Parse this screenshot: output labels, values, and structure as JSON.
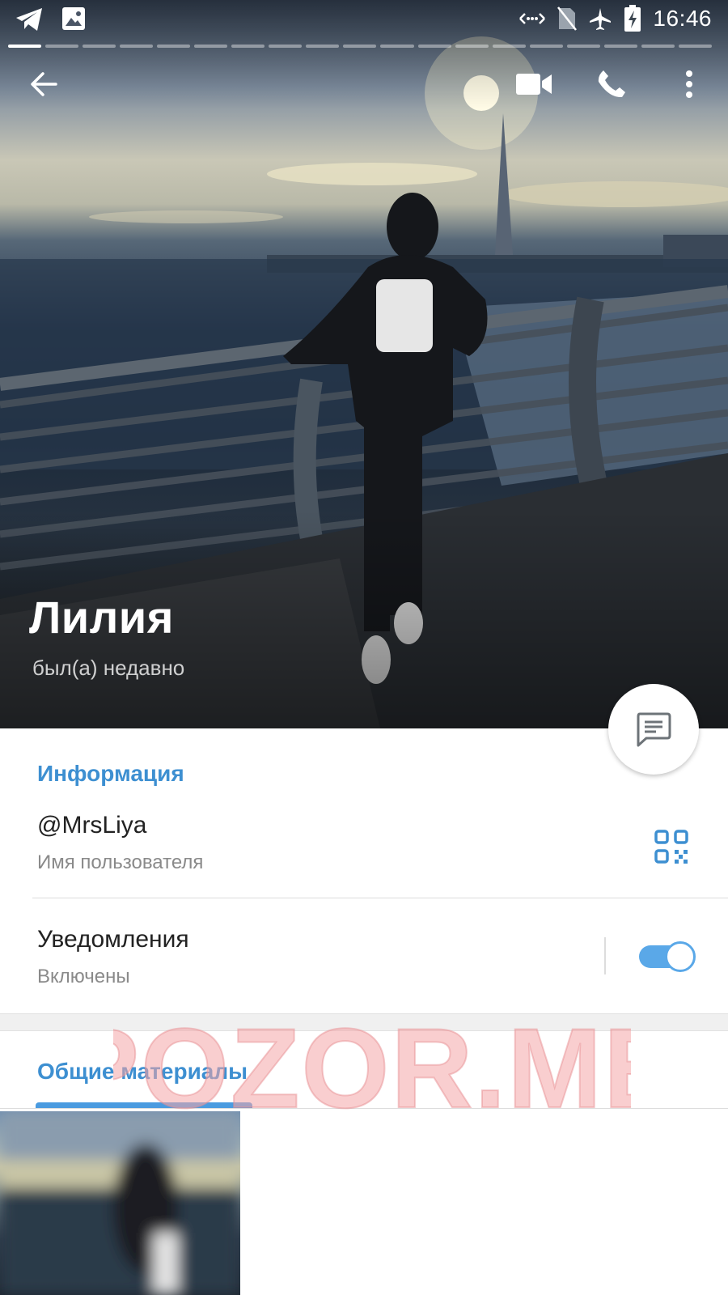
{
  "status_bar": {
    "time": "16:46",
    "left_icons": [
      "telegram-icon",
      "image-icon"
    ],
    "right_icons": [
      "data-sync-icon",
      "no-sim-icon",
      "airplane-icon",
      "battery-charging-icon"
    ]
  },
  "story": {
    "segments": 19,
    "active_index": 0
  },
  "topbar": {
    "icons": [
      "back-arrow-icon",
      "video-call-icon",
      "phone-icon",
      "more-vert-icon"
    ]
  },
  "profile": {
    "name": "Лилия",
    "status": "был(а) недавно"
  },
  "info": {
    "section_title": "Информация",
    "username": "@MrsLiya",
    "username_caption": "Имя пользователя",
    "notifications_label": "Уведомления",
    "notifications_state": "Включены",
    "notifications_on": true
  },
  "shared": {
    "tab_label": "Общие материалы"
  },
  "watermark": "POZOR.ME",
  "colors": {
    "accent": "#3d8fd1",
    "toggle": "#5aa8e8",
    "watermark": "#f4a5a8"
  }
}
